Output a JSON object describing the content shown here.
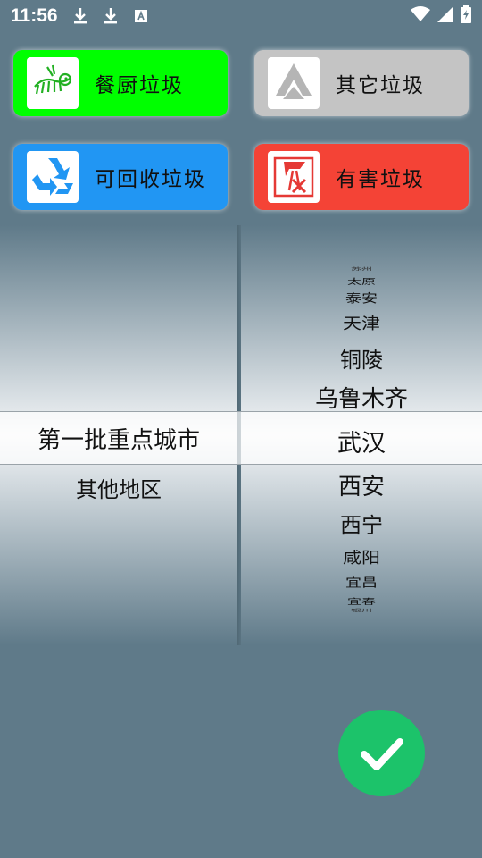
{
  "status_bar": {
    "time": "11:56",
    "icons": [
      "download-icon",
      "download-icon",
      "text-icon"
    ],
    "right_icons": [
      "wifi-icon",
      "signal-icon",
      "battery-icon"
    ]
  },
  "categories": [
    {
      "label": "餐厨垃圾",
      "color": "#00ff00",
      "icon": "fish-bone-icon"
    },
    {
      "label": "其它垃圾",
      "color": "#c4c4c4",
      "icon": "recycle-triangle-icon"
    },
    {
      "label": "可回收垃圾",
      "color": "#2196f3",
      "icon": "recycle-icon"
    },
    {
      "label": "有害垃圾",
      "color": "#f44336",
      "icon": "hazard-icon"
    }
  ],
  "picker": {
    "left_items": [
      "第一批重点城市",
      "其他地区"
    ],
    "left_selected": "第一批重点城市",
    "right_items": [
      "苏州",
      "太原",
      "泰安",
      "天津",
      "铜陵",
      "乌鲁木齐",
      "武汉",
      "西安",
      "西宁",
      "咸阳",
      "宜昌",
      "宜春",
      "银川"
    ],
    "right_selected": "武汉"
  },
  "confirm_icon": "check-icon",
  "colors": {
    "background": "#5f7a89",
    "confirm": "#1cc36a"
  }
}
